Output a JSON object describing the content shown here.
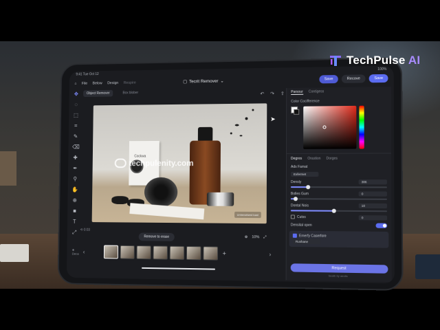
{
  "brand": {
    "name": "TechPulse",
    "suffix": "AI"
  },
  "status": {
    "time": "9:41",
    "date": "Tue Oct 12",
    "signal": "100%"
  },
  "menu": {
    "file": "File",
    "items": [
      "Below",
      "Design"
    ],
    "dim_item": "Respire"
  },
  "document": {
    "title": "Tecrit Remover"
  },
  "header_buttons": {
    "save": "Save",
    "recove": "Recove",
    "save2": "Save"
  },
  "subtabs": {
    "active": "Object Remover",
    "secondary": "Box blober"
  },
  "photo": {
    "watermark": "techpulenity.com",
    "box_label": "Cockwa",
    "badge": "Unhendrized load"
  },
  "canvas_footer": {
    "time": "0:03",
    "remove_hint": "Remove to erase",
    "zoom": "10%"
  },
  "filmstrip": {
    "label": "Deca",
    "count": 7
  },
  "panel": {
    "tabs": [
      "Parsour",
      "Contigess"
    ],
    "color_section": "Color Cocifference",
    "prop_tabs": [
      "Degres",
      "Orastion",
      "Dorges"
    ],
    "ads_format": "Ads Famat",
    "layer": "Exfermet",
    "density": {
      "label": "Densly",
      "value": "306",
      "level": 0.18
    },
    "bolles_gum": {
      "label": "Bolles Gum",
      "value": "0",
      "level": 0.05
    },
    "dontal": {
      "label": "Dontal Nois",
      "value": "10",
      "level": 0.45
    },
    "cutss": {
      "label": "Cutss",
      "value": "0"
    },
    "densital": {
      "label": "Densital open"
    },
    "section_emphasis": "Emerfy Caserfore",
    "selected_item": "Rushane",
    "request_button": "Request",
    "footnote": "Seatb by aeolis"
  }
}
